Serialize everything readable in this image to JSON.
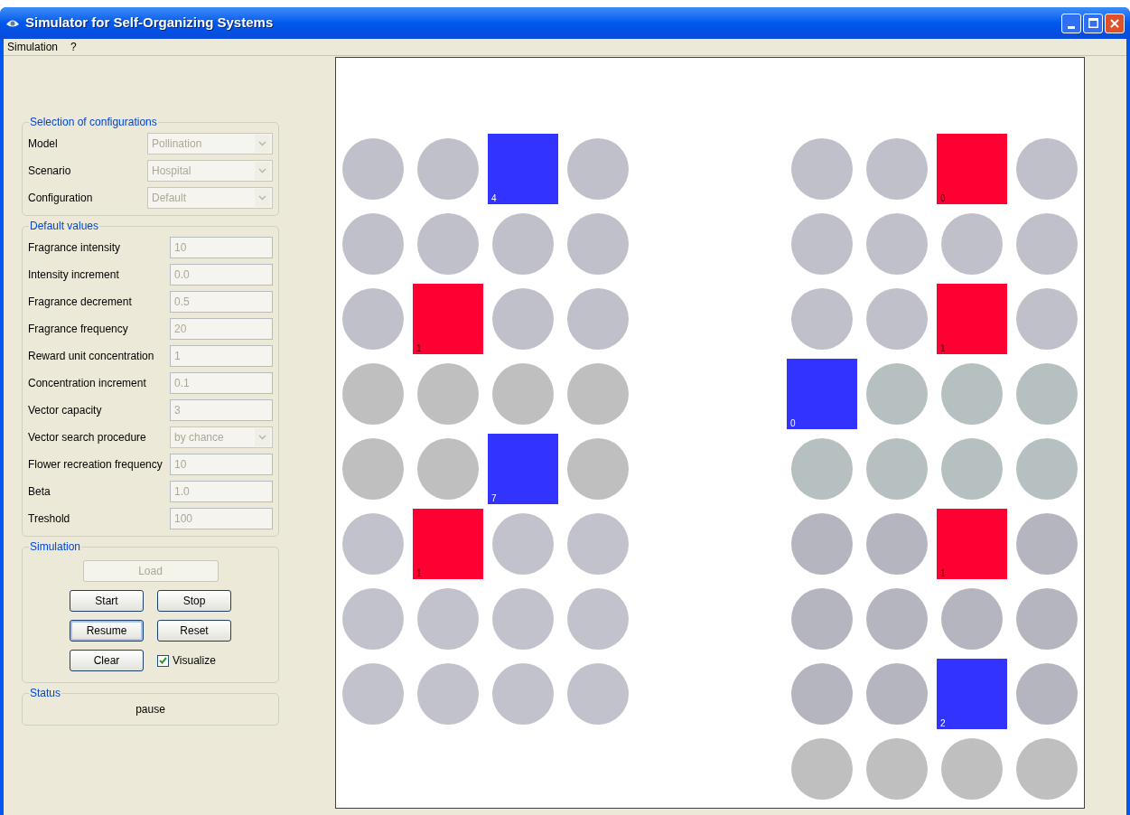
{
  "window": {
    "title": "Simulator for Self-Organizing Systems"
  },
  "menu": [
    {
      "label": "Simulation"
    },
    {
      "label": "?"
    }
  ],
  "configuration_group": {
    "title": "Selection of configurations",
    "rows": [
      {
        "label": "Model",
        "value": "Pollination",
        "kind": "combo",
        "disabled": true
      },
      {
        "label": "Scenario",
        "value": "Hospital",
        "kind": "combo",
        "disabled": true
      },
      {
        "label": "Configuration",
        "value": "Default",
        "kind": "combo",
        "disabled": true
      }
    ]
  },
  "defaults_group": {
    "title": "Default values",
    "rows": [
      {
        "label": "Fragrance intensity",
        "value": "10",
        "kind": "text",
        "disabled": true
      },
      {
        "label": "Intensity increment",
        "value": "0.0",
        "kind": "text",
        "disabled": true
      },
      {
        "label": "Fragrance decrement",
        "value": "0.5",
        "kind": "text",
        "disabled": true
      },
      {
        "label": "Fragrance frequency",
        "value": "20",
        "kind": "text",
        "disabled": true
      },
      {
        "label": "Reward unit concentration",
        "value": "1",
        "kind": "text",
        "disabled": true
      },
      {
        "label": "Concentration increment",
        "value": "0.1",
        "kind": "text",
        "disabled": true
      },
      {
        "label": "Vector capacity",
        "value": "3",
        "kind": "text",
        "disabled": true
      },
      {
        "label": "Vector search procedure",
        "value": "by chance",
        "kind": "combo",
        "disabled": true
      },
      {
        "label": "Flower recreation frequency",
        "value": "10",
        "kind": "text",
        "disabled": true
      },
      {
        "label": "Beta",
        "value": "1.0",
        "kind": "text",
        "disabled": true
      },
      {
        "label": "Treshold",
        "value": "100",
        "kind": "text",
        "disabled": true
      }
    ]
  },
  "simulation_group": {
    "title": "Simulation",
    "buttons": [
      {
        "label": "Load",
        "disabled": true,
        "focused": false
      },
      {
        "label": "Start",
        "disabled": false,
        "focused": false
      },
      {
        "label": "Stop",
        "disabled": false,
        "focused": false
      },
      {
        "label": "Resume",
        "disabled": false,
        "focused": true
      },
      {
        "label": "Reset",
        "disabled": false,
        "focused": false
      },
      {
        "label": "Clear",
        "disabled": false,
        "focused": false
      }
    ],
    "visualize": {
      "label": "Visualize",
      "checked": true
    }
  },
  "status_group": {
    "title": "Status",
    "value": "pause"
  },
  "canvas": {
    "blocks": [
      {
        "rows": [
          {
            "color": "#c0c0ca",
            "cells": [
              {
                "kind": "circle"
              },
              {
                "kind": "circle"
              },
              {
                "kind": "square",
                "color": "#3333ff",
                "label": "4"
              },
              {
                "kind": "circle"
              }
            ]
          },
          {
            "color": "#c0c0ca",
            "cells": [
              {
                "kind": "circle"
              },
              {
                "kind": "circle"
              },
              {
                "kind": "circle"
              },
              {
                "kind": "circle"
              }
            ]
          },
          {
            "color": "#c0c0ca",
            "cells": [
              {
                "kind": "circle"
              },
              {
                "kind": "square",
                "color": "#ff0033",
                "label": "1"
              },
              {
                "kind": "circle"
              },
              {
                "kind": "circle"
              }
            ]
          },
          {
            "color": "#bfbfbf",
            "cells": [
              {
                "kind": "circle"
              },
              {
                "kind": "circle"
              },
              {
                "kind": "circle"
              },
              {
                "kind": "circle"
              }
            ]
          },
          {
            "color": "#bfbfbf",
            "cells": [
              {
                "kind": "circle"
              },
              {
                "kind": "circle"
              },
              {
                "kind": "square",
                "color": "#3333ff",
                "label": "7"
              },
              {
                "kind": "circle"
              }
            ]
          },
          {
            "color": "#c2c2cc",
            "cells": [
              {
                "kind": "circle"
              },
              {
                "kind": "square",
                "color": "#ff0033",
                "label": "1"
              },
              {
                "kind": "circle"
              },
              {
                "kind": "circle"
              }
            ]
          },
          {
            "color": "#c2c2cc",
            "cells": [
              {
                "kind": "circle"
              },
              {
                "kind": "circle"
              },
              {
                "kind": "circle"
              },
              {
                "kind": "circle"
              }
            ]
          },
          {
            "color": "#c2c2cc",
            "cells": [
              {
                "kind": "circle"
              },
              {
                "kind": "circle"
              },
              {
                "kind": "circle"
              },
              {
                "kind": "circle"
              }
            ]
          }
        ]
      },
      {
        "rows": [
          {
            "color": "#c0c0ca",
            "cells": [
              {
                "kind": "circle"
              },
              {
                "kind": "circle"
              },
              {
                "kind": "square",
                "color": "#ff0033",
                "label": "0"
              },
              {
                "kind": "circle"
              }
            ]
          },
          {
            "color": "#c0c0ca",
            "cells": [
              {
                "kind": "circle"
              },
              {
                "kind": "circle"
              },
              {
                "kind": "circle"
              },
              {
                "kind": "circle"
              }
            ]
          },
          {
            "color": "#c0c0ca",
            "cells": [
              {
                "kind": "circle"
              },
              {
                "kind": "circle"
              },
              {
                "kind": "square",
                "color": "#ff0033",
                "label": "1"
              },
              {
                "kind": "circle"
              }
            ]
          },
          {
            "color": "#b7c0c0",
            "cells": [
              {
                "kind": "square",
                "color": "#3333ff",
                "label": "0"
              },
              {
                "kind": "circle"
              },
              {
                "kind": "circle"
              },
              {
                "kind": "circle"
              }
            ]
          },
          {
            "color": "#b7c0c0",
            "cells": [
              {
                "kind": "circle"
              },
              {
                "kind": "circle"
              },
              {
                "kind": "circle"
              },
              {
                "kind": "circle"
              }
            ]
          },
          {
            "color": "#b5b5c0",
            "cells": [
              {
                "kind": "circle"
              },
              {
                "kind": "circle"
              },
              {
                "kind": "square",
                "color": "#ff0033",
                "label": "1"
              },
              {
                "kind": "circle"
              }
            ]
          },
          {
            "color": "#b5b5c0",
            "cells": [
              {
                "kind": "circle"
              },
              {
                "kind": "circle"
              },
              {
                "kind": "circle"
              },
              {
                "kind": "circle"
              }
            ]
          },
          {
            "color": "#b5b5c0",
            "cells": [
              {
                "kind": "circle"
              },
              {
                "kind": "circle"
              },
              {
                "kind": "square",
                "color": "#3333ff",
                "label": "2"
              },
              {
                "kind": "circle"
              }
            ]
          },
          {
            "color": "#bfbfbf",
            "cells": [
              {
                "kind": "circle"
              },
              {
                "kind": "circle"
              },
              {
                "kind": "circle"
              },
              {
                "kind": "circle"
              }
            ]
          }
        ]
      }
    ]
  }
}
